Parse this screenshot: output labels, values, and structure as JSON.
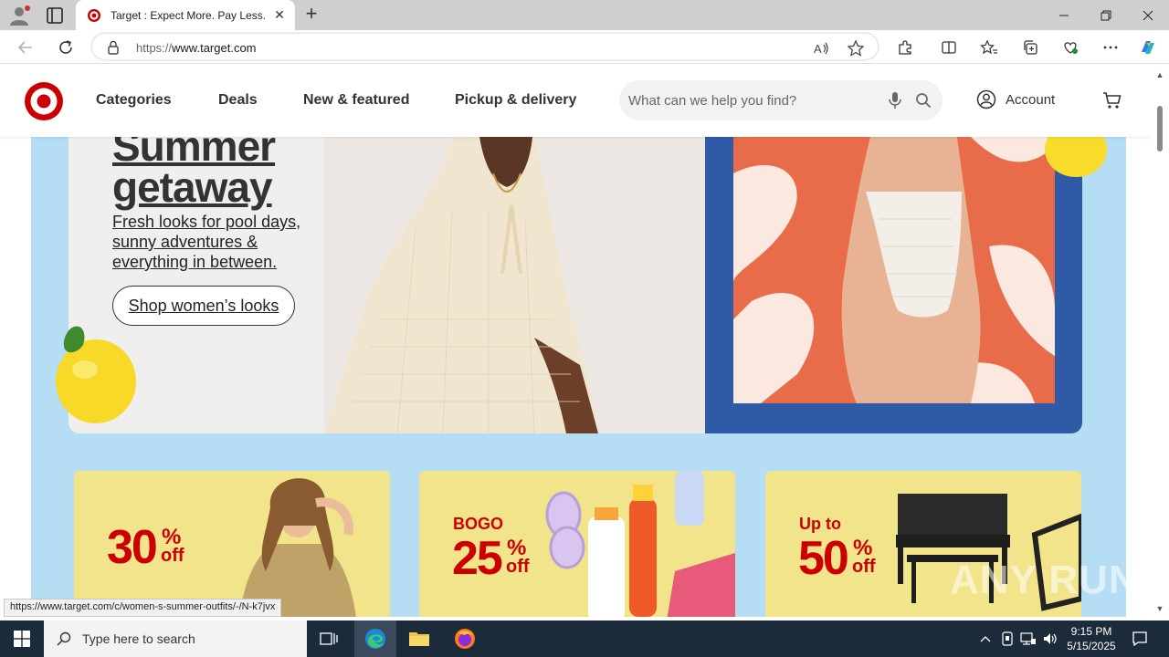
{
  "browser": {
    "tab_title": "Target : Expect More. Pay Less.",
    "url_scheme": "https://",
    "url_host": "www.target.com",
    "status_url": "https://www.target.com/c/women-s-summer-outfits/-/N-k7jvx"
  },
  "site": {
    "nav": [
      "Categories",
      "Deals",
      "New & featured",
      "Pickup & delivery"
    ],
    "search_placeholder": "What can we help you find?",
    "account_label": "Account",
    "brand_color": "#cc0000"
  },
  "hero": {
    "title_line1": "Summer",
    "title_line2": "getaway",
    "subtitle": "Fresh looks for pool days, sunny adventures & everything in between.",
    "cta": "Shop women’s looks"
  },
  "promos": [
    {
      "pre": "",
      "number": "30",
      "pct": "%",
      "off": "off"
    },
    {
      "pre": "BOGO",
      "number": "25",
      "pct": "%",
      "off": "off"
    },
    {
      "pre": "Up to",
      "number": "50",
      "pct": "%",
      "off": "off"
    }
  ],
  "watermark": "ANY RUN",
  "taskbar": {
    "search_placeholder": "Type here to search",
    "time": "9:15 PM",
    "date": "5/15/2025"
  }
}
